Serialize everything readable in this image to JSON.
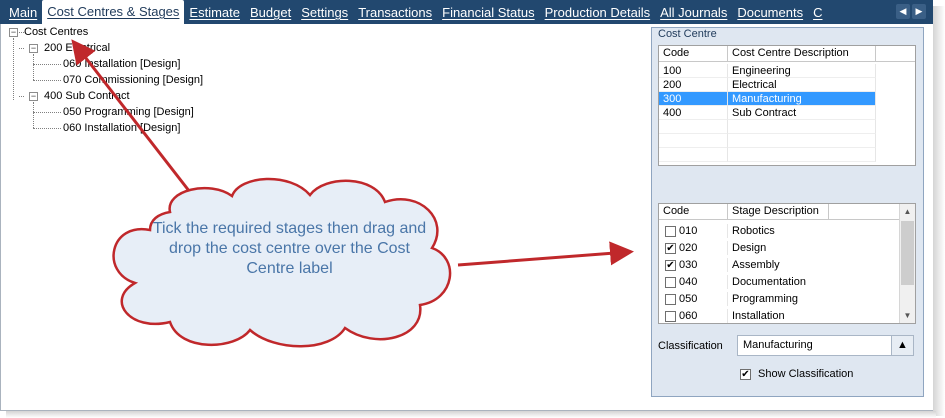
{
  "tabs": [
    {
      "label": "Main",
      "active": false
    },
    {
      "label": "Cost Centres & Stages",
      "active": true
    },
    {
      "label": "Estimate",
      "active": false
    },
    {
      "label": "Budget",
      "active": false
    },
    {
      "label": "Settings",
      "active": false
    },
    {
      "label": "Transactions",
      "active": false
    },
    {
      "label": "Financial Status",
      "active": false
    },
    {
      "label": "Production Details",
      "active": false
    },
    {
      "label": "All Journals",
      "active": false
    },
    {
      "label": "Documents",
      "active": false
    },
    {
      "label": "C",
      "active": false
    }
  ],
  "tree": {
    "root": "Cost Centres",
    "root_expander": "−",
    "node_200": "200 Electrical",
    "node_200_expander": "−",
    "node_200_children": [
      "060 Installation [Design]",
      "070 Commissioning [Design]"
    ],
    "node_400": "400 Sub Contract",
    "node_400_expander": "−",
    "node_400_children": [
      "050 Programming [Design]",
      "060 Installation [Design]"
    ]
  },
  "cost_centre_panel": {
    "title": "Cost Centre",
    "columns": [
      "Code",
      "Cost Centre Description"
    ],
    "rows": [
      {
        "code": "100",
        "desc": "Engineering"
      },
      {
        "code": "200",
        "desc": "Electrical"
      },
      {
        "code": "300",
        "desc": "Manufacturing"
      },
      {
        "code": "400",
        "desc": "Sub Contract"
      }
    ],
    "selected_code": "300"
  },
  "stages_grid": {
    "columns": [
      "Code",
      "Stage Description"
    ],
    "rows": [
      {
        "code": "010",
        "desc": "Robotics",
        "checked": false
      },
      {
        "code": "020",
        "desc": "Design",
        "checked": true
      },
      {
        "code": "030",
        "desc": "Assembly",
        "checked": true
      },
      {
        "code": "040",
        "desc": "Documentation",
        "checked": false
      },
      {
        "code": "050",
        "desc": "Programming",
        "checked": false
      },
      {
        "code": "060",
        "desc": "Installation",
        "checked": false
      }
    ],
    "scroll_up": "▲",
    "scroll_down": "▼",
    "check_mark": "✔"
  },
  "classification": {
    "label": "Classification",
    "value": "Manufacturing",
    "button_glyph": "▲",
    "show_label": "Show Classification",
    "show_checked": true
  },
  "tab_scroll": {
    "left": "◀",
    "right": "▶"
  },
  "callout": {
    "text": "Tick the required stages then drag and drop the cost centre over the Cost Centre label"
  },
  "colors": {
    "tab_bar": "#22486f",
    "panel_bg": "#dfe7f1",
    "selection": "#3399ff",
    "callout_fill": "#e7eef7",
    "callout_text": "#4a76a8",
    "arrow": "#c0282b"
  }
}
